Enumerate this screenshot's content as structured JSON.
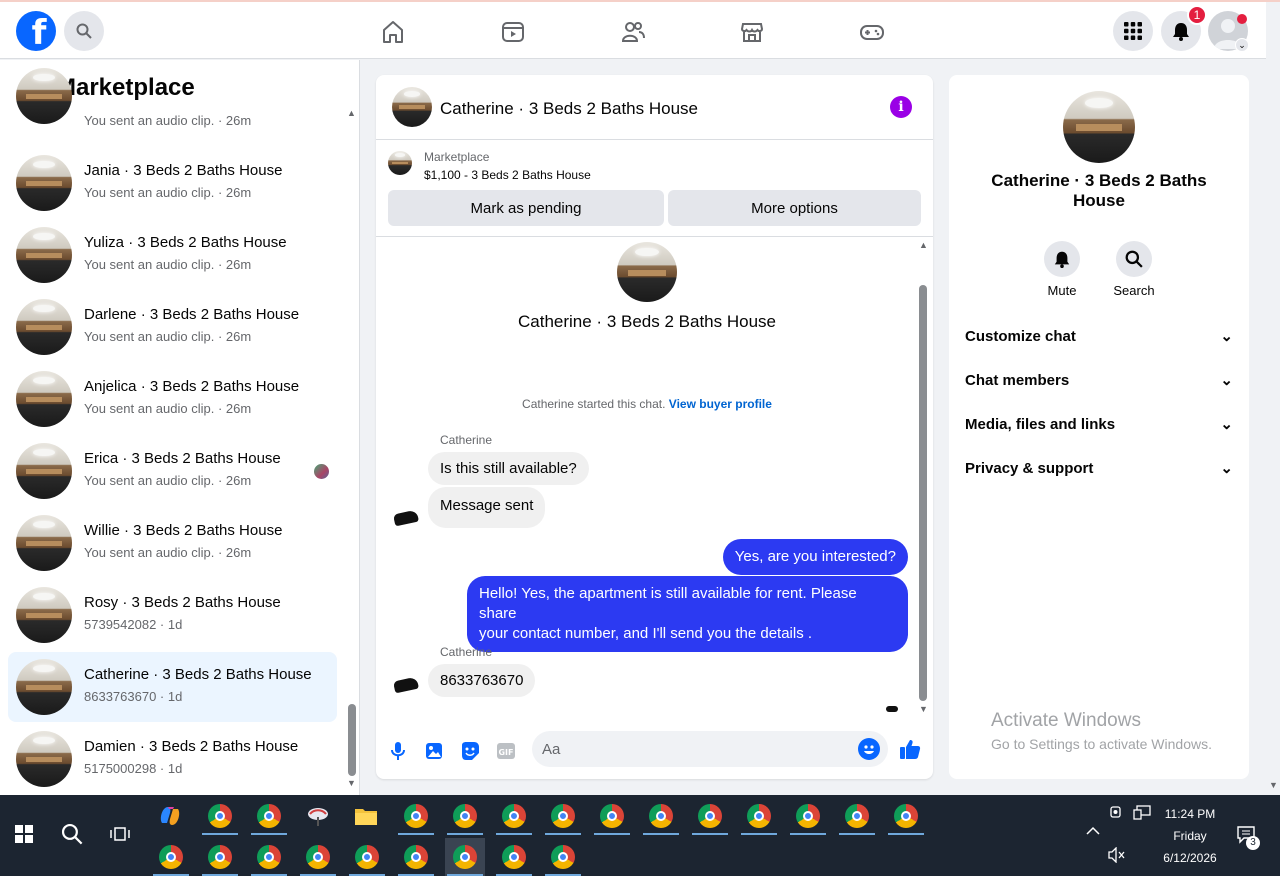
{
  "topbar": {
    "logo": "f",
    "notification_count": "1"
  },
  "marketplace": {
    "title": "Marketplace",
    "partial_item_sub": "You sent an audio clip. · 26m",
    "conversations": [
      {
        "name": "Jania · 3 Beds 2 Baths House",
        "sub": "You sent an audio clip. · 26m"
      },
      {
        "name": "Yuliza · 3 Beds 2 Baths House",
        "sub": "You sent an audio clip. · 26m"
      },
      {
        "name": "Darlene · 3 Beds 2 Baths House",
        "sub": "You sent an audio clip. · 26m"
      },
      {
        "name": "Anjelica · 3 Beds 2 Baths House",
        "sub": "You sent an audio clip. · 26m"
      },
      {
        "name": "Erica · 3 Beds 2 Baths House",
        "sub": "You sent an audio clip. · 26m"
      },
      {
        "name": "Willie · 3 Beds 2 Baths House",
        "sub": "You sent an audio clip. · 26m"
      },
      {
        "name": "Rosy · 3 Beds 2 Baths House",
        "sub": "5739542082 · 1d"
      },
      {
        "name": "Catherine · 3 Beds 2 Baths House",
        "sub": "8633763670 · 1d"
      },
      {
        "name": "Damien · 3 Beds 2 Baths House",
        "sub": "5175000298 · 1d"
      }
    ]
  },
  "chat": {
    "title": "Catherine · 3 Beds 2 Baths House",
    "listing_label": "Marketplace",
    "listing_price": "$1,100 - 3 Beds 2 Baths House",
    "mark_pending": "Mark as pending",
    "more_options": "More options",
    "header_name": "Catherine · 3 Beds 2 Baths House",
    "started_text": "Catherine started this chat.",
    "buyer_link": "View buyer profile",
    "messages": [
      {
        "sender": "Catherine",
        "text": "Is this still available?"
      },
      {
        "text": "Message sent"
      },
      {
        "text": "Yes, are you interested?"
      },
      {
        "text_line1": "Hello! Yes, the apartment is still available for rent. Please share",
        "text_line2": "your contact number, and I'll send you the details ."
      },
      {
        "sender": "Catherine",
        "text": "8633763670"
      }
    ],
    "composer_placeholder": "Aa"
  },
  "details": {
    "name": "Catherine · 3 Beds 2 Baths House",
    "mute": "Mute",
    "search": "Search",
    "sections": [
      "Customize chat",
      "Chat members",
      "Media, files and links",
      "Privacy & support"
    ]
  },
  "watermark": {
    "line1": "Activate Windows",
    "line2": "Go to Settings to activate Windows."
  },
  "taskbar": {
    "time": "11:24 PM",
    "day": "Friday",
    "date": "6/12/2026",
    "notif_count": "3"
  },
  "colors": {
    "brand": "#0866ff",
    "outgoing_bubble": "#2c3af2",
    "info_purple": "#9a00e6",
    "badge_red": "#e41e3f"
  }
}
